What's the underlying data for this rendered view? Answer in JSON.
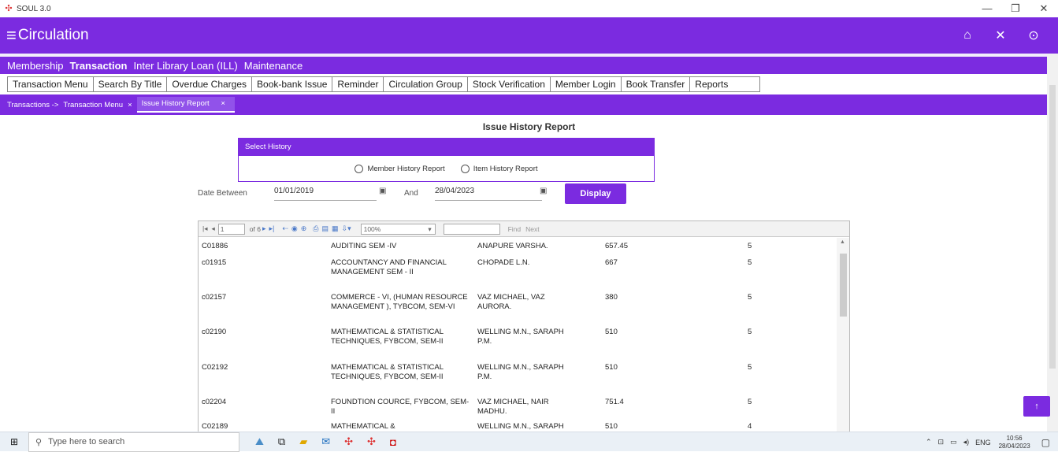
{
  "window": {
    "title": "SOUL 3.0",
    "controls": [
      "—",
      "❐",
      "✕"
    ]
  },
  "header": {
    "title": "Circulation",
    "icons": [
      "home-icon",
      "close-icon",
      "help-icon"
    ]
  },
  "modules": [
    "Membership",
    "Transaction",
    "Inter Library Loan (ILL)",
    "Maintenance"
  ],
  "active_module": "Transaction",
  "submenu": [
    "Transaction Menu",
    "Search By Title",
    "Overdue Charges",
    "Book-bank Issue",
    "Reminder",
    "Circulation Group",
    "Stock Verification",
    "Member Login",
    "Book Transfer",
    "Reports"
  ],
  "breadcrumb": {
    "root": "Transactions ->",
    "item1": "Transaction Menu",
    "sep1": "×",
    "current": "Issue History Report",
    "sep2": "×"
  },
  "report": {
    "title": "Issue History Report",
    "select_header": "Select History",
    "radio1": "Member History Report",
    "radio2": "Item History Report",
    "date_label": "Date Between",
    "from_date": "01/01/2019",
    "and_label": "And",
    "to_date": "28/04/2023",
    "display_button": "Display"
  },
  "viewer": {
    "page": "1",
    "of_pages": "of 6",
    "zoom": "100%",
    "find": "Find",
    "next": "Next",
    "rows": [
      {
        "acc": "C01886",
        "title": "AUDITING SEM -IV",
        "author": "ANAPURE VARSHA.",
        "price": "657.45",
        "copies": "5"
      },
      {
        "acc": "c01915",
        "title": "ACCOUNTANCY AND FINANCIAL MANAGEMENT SEM - II",
        "author": "CHOPADE L.N.",
        "price": "667",
        "copies": "5"
      },
      {
        "acc": "c02157",
        "title": "COMMERCE - VI, (HUMAN RESOURCE MANAGEMENT ), TYBCOM, SEM-VI",
        "author": "VAZ MICHAEL, VAZ AURORA.",
        "price": "380",
        "copies": "5"
      },
      {
        "acc": "c02190",
        "title": "MATHEMATICAL & STATISTICAL TECHNIQUES, FYBCOM, SEM-II",
        "author": "WELLING M.N., SARAPH P.M.",
        "price": "510",
        "copies": "5"
      },
      {
        "acc": "C02192",
        "title": "MATHEMATICAL & STATISTICAL TECHNIQUES, FYBCOM, SEM-II",
        "author": "WELLING M.N., SARAPH P.M.",
        "price": "510",
        "copies": "5"
      },
      {
        "acc": "c02204",
        "title": "FOUNDTION COURCE, FYBCOM, SEM-II",
        "author": "VAZ MICHAEL, NAIR MADHU.",
        "price": "751.4",
        "copies": "5"
      },
      {
        "acc": "C02189",
        "title": "MATHEMATICAL &",
        "author": "WELLING M.N., SARAPH",
        "price": "510",
        "copies": "4"
      }
    ]
  },
  "taskbar": {
    "search_placeholder": "Type here to search",
    "lang": "ENG",
    "time": "10:56",
    "date": "28/04/2023"
  }
}
